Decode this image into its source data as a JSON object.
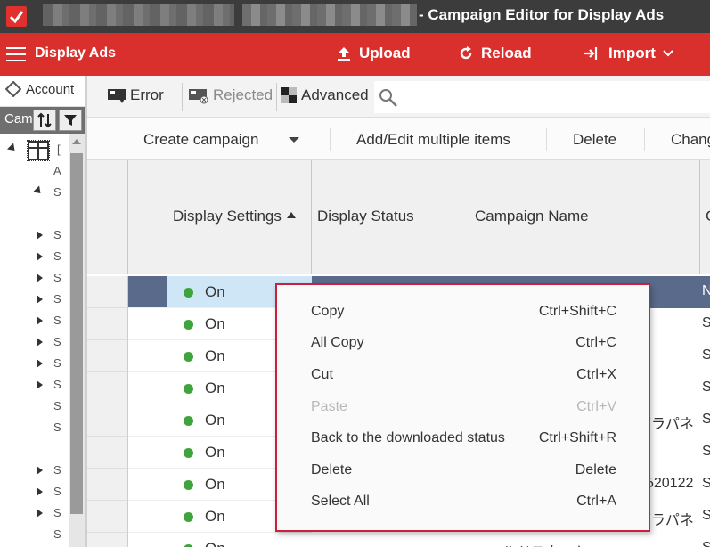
{
  "window": {
    "title": "- Campaign Editor for Display Ads"
  },
  "toolbar": {
    "app_name": "Display Ads",
    "upload_label": "Upload",
    "reload_label": "Reload",
    "import_label": "Import"
  },
  "left_panel": {
    "account_tab": "Account",
    "campaign_tab": "Cam",
    "tree_items": [
      {
        "label": "[",
        "expanded": true,
        "level": 0
      },
      {
        "label": "A",
        "expanded": null,
        "level": 1
      },
      {
        "label": "S",
        "expanded": true,
        "level": 1
      },
      {
        "label": "S",
        "expanded": false,
        "level": 1
      },
      {
        "label": "S",
        "expanded": false,
        "level": 1
      },
      {
        "label": "S",
        "expanded": false,
        "level": 1
      },
      {
        "label": "S",
        "expanded": false,
        "level": 1
      },
      {
        "label": "S",
        "expanded": false,
        "level": 1
      },
      {
        "label": "S",
        "expanded": false,
        "level": 1
      },
      {
        "label": "S",
        "expanded": false,
        "level": 1
      },
      {
        "label": "S",
        "expanded": false,
        "level": 1
      },
      {
        "label": "S",
        "expanded": null,
        "level": 1
      },
      {
        "label": "S",
        "expanded": null,
        "level": 1
      },
      {
        "label": "S",
        "expanded": false,
        "level": 1
      },
      {
        "label": "S",
        "expanded": false,
        "level": 1
      },
      {
        "label": "S",
        "expanded": false,
        "level": 1
      },
      {
        "label": "S",
        "expanded": null,
        "level": 1
      }
    ]
  },
  "filters": {
    "error_label": "Error",
    "rejected_label": "Rejected",
    "advanced_label": "Advanced"
  },
  "actions": {
    "create_campaign": "Create campaign",
    "add_edit_multiple": "Add/Edit multiple items",
    "delete": "Delete",
    "change": "Chang"
  },
  "grid": {
    "columns": [
      "Display Settings",
      "Display Status",
      "Campaign Name",
      "C"
    ],
    "rows": [
      {
        "status": "On",
        "campaign": "",
        "last": "N"
      },
      {
        "status": "On",
        "campaign": "",
        "last": "S"
      },
      {
        "status": "On",
        "campaign": "",
        "last": "S"
      },
      {
        "status": "On",
        "campaign": "",
        "last": "S"
      },
      {
        "status": "On",
        "campaign": "グラパネ",
        "last": "S"
      },
      {
        "status": "On",
        "campaign": "",
        "last": "S"
      },
      {
        "status": "On",
        "campaign": "520122",
        "last": "S"
      },
      {
        "status": "On",
        "campaign": "グラパネ",
        "last": "S"
      },
      {
        "status": "On",
        "campaign": "コールドスタートCMP",
        "last": "S"
      }
    ]
  },
  "context_menu": {
    "items": [
      {
        "label": "Copy",
        "shortcut": "Ctrl+Shift+C",
        "enabled": true
      },
      {
        "label": "All Copy",
        "shortcut": "Ctrl+C",
        "enabled": true
      },
      {
        "label": "Cut",
        "shortcut": "Ctrl+X",
        "enabled": true
      },
      {
        "label": "Paste",
        "shortcut": "Ctrl+V",
        "enabled": false
      },
      {
        "label": "Back to the downloaded status",
        "shortcut": "Ctrl+Shift+R",
        "enabled": true
      },
      {
        "label": "Delete",
        "shortcut": "Delete",
        "enabled": true
      },
      {
        "label": "Select All",
        "shortcut": "Ctrl+A",
        "enabled": true
      }
    ]
  },
  "colors": {
    "brand_red": "#d9302e",
    "menu_border": "#cc1f3c",
    "status_on": "#3ea43e",
    "selected_row": "#5a6a8a"
  }
}
